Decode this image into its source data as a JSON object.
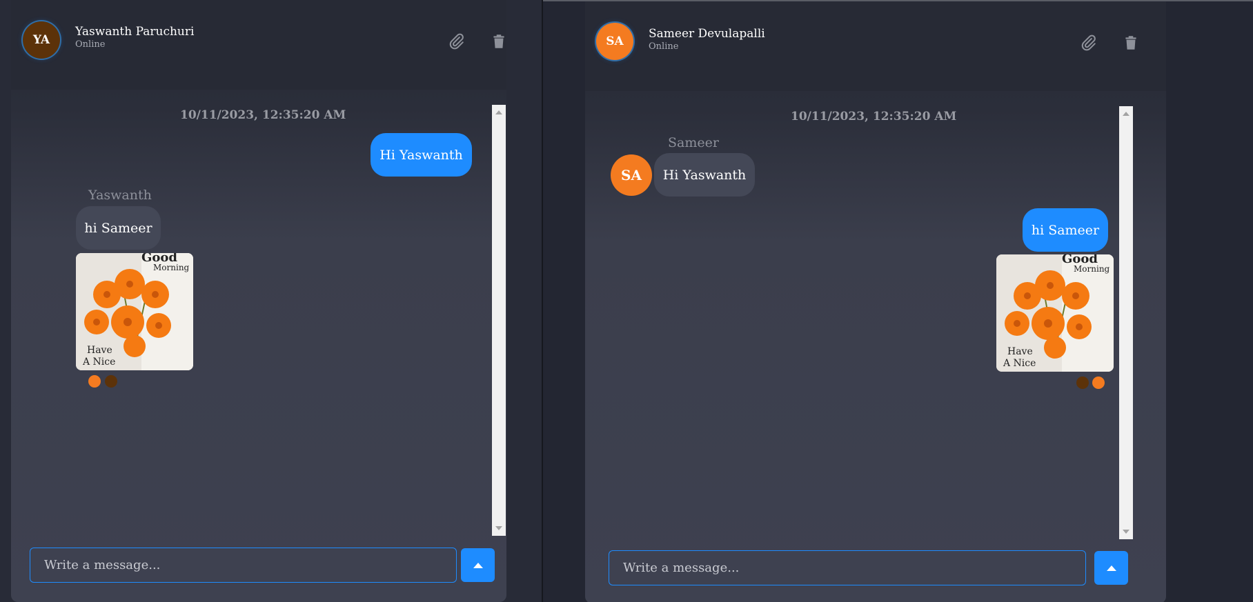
{
  "accent_color": "#1e8cff",
  "left_chat": {
    "header": {
      "avatar_initials": "YA",
      "avatar_color": "#5c3209",
      "name": "Yaswanth Paruchuri",
      "status": "Online",
      "attach_icon": "paperclip-icon",
      "delete_icon": "trash-icon"
    },
    "timestamp": "10/11/2023, 12:35:20 AM",
    "messages": [
      {
        "direction": "outgoing",
        "text": "Hi Yaswanth"
      },
      {
        "direction": "incoming",
        "sender": "Yaswanth",
        "text": "hi Sameer"
      }
    ],
    "image": {
      "text_top": "Good",
      "text_morning": "Morning",
      "text_have": "Have",
      "text_anice": "A Nice"
    },
    "input_placeholder": "Write a message...",
    "send_icon": "arrow-up-icon"
  },
  "right_chat": {
    "header": {
      "avatar_initials": "SA",
      "avatar_color": "#f47b20",
      "name": "Sameer Devulapalli",
      "status": "Online",
      "attach_icon": "paperclip-icon",
      "delete_icon": "trash-icon"
    },
    "timestamp": "10/11/2023, 12:35:20 AM",
    "messages": [
      {
        "direction": "incoming",
        "sender": "Sameer",
        "avatar_initials": "SA",
        "text": "Hi Yaswanth"
      },
      {
        "direction": "outgoing",
        "text": "hi Sameer"
      }
    ],
    "image": {
      "text_top": "Good",
      "text_morning": "Morning",
      "text_have": "Have",
      "text_anice": "A Nice"
    },
    "input_placeholder": "Write a message...",
    "send_icon": "arrow-up-icon"
  }
}
